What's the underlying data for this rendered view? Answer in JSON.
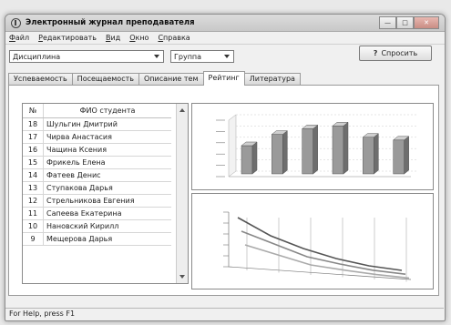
{
  "window": {
    "title": "Электронный журнал преподавателя"
  },
  "menu": [
    {
      "id": "file",
      "underlined": "Ф",
      "rest": "айл"
    },
    {
      "id": "edit",
      "underlined": "Р",
      "rest": "едактировать"
    },
    {
      "id": "view",
      "underlined": "В",
      "rest": "ид"
    },
    {
      "id": "window",
      "underlined": "О",
      "rest": "кно"
    },
    {
      "id": "help",
      "underlined": "С",
      "rest": "правка"
    }
  ],
  "toolbar": {
    "discipline": "Дисциплина",
    "group": "Группа",
    "ask_button": "Спросить"
  },
  "tabs": [
    "Успеваемость",
    "Посещаемость",
    "Описание тем",
    "Рейтинг",
    "Литература"
  ],
  "active_tab": "Рейтинг",
  "students": {
    "headers": {
      "num": "№",
      "name": "ФИО студента"
    },
    "rows": [
      {
        "num": "18",
        "name": "Шульгин Дмитрий"
      },
      {
        "num": "17",
        "name": "Чирва Анастасия"
      },
      {
        "num": "16",
        "name": "Чащина Ксения"
      },
      {
        "num": "15",
        "name": "Фрикель Елена"
      },
      {
        "num": "14",
        "name": "Фатеев Денис"
      },
      {
        "num": "13",
        "name": "Ступакова Дарья"
      },
      {
        "num": "12",
        "name": "Стрельникова Евгения"
      },
      {
        "num": "11",
        "name": "Сапеева Екатерина"
      },
      {
        "num": "10",
        "name": "Нановский Кирилл"
      },
      {
        "num": "9",
        "name": "Мещерова Дарья"
      }
    ]
  },
  "chart_data": [
    {
      "type": "bar",
      "title": "",
      "categories": [
        "",
        "",
        "",
        "",
        "",
        ""
      ],
      "values": [
        5,
        7,
        8,
        8.5,
        6.5,
        6
      ],
      "ylim": [
        0,
        10
      ],
      "grid": true
    },
    {
      "type": "line",
      "title": "",
      "series": [
        {
          "values": [
            9,
            6,
            4,
            2.5,
            1.5,
            1
          ]
        },
        {
          "values": [
            7,
            5,
            3,
            2,
            1.2,
            0.8
          ]
        },
        {
          "values": [
            5,
            3.5,
            2,
            1.4,
            0.9,
            0.6
          ]
        }
      ],
      "ylim": [
        0,
        10
      ],
      "grid": true
    }
  ],
  "status": "For Help, press F1"
}
